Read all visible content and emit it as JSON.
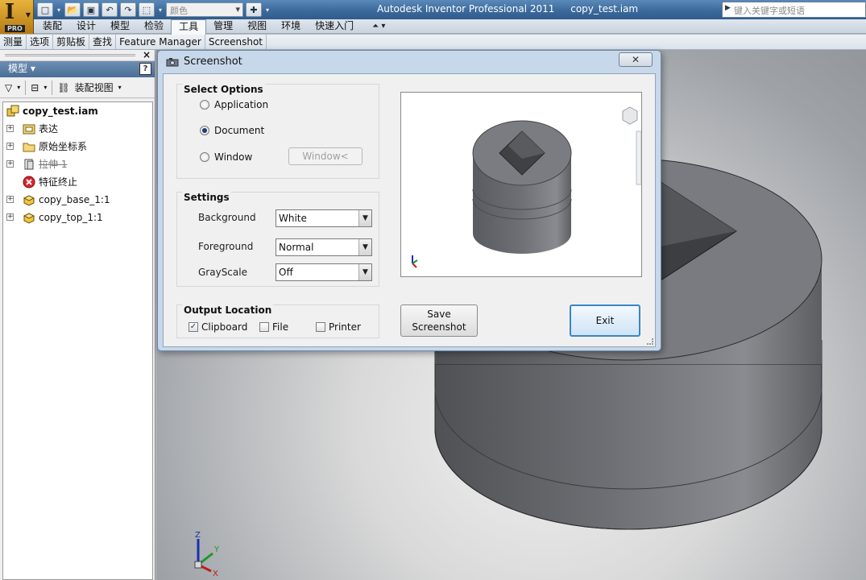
{
  "app": {
    "title": "Autodesk Inventor Professional 2011",
    "document": "copy_test.iam",
    "logo_letter": "I",
    "logo_badge": "PRO",
    "color_combo": "颜色",
    "search_placeholder": "键入关键字或短语"
  },
  "ribbon": {
    "tabs": [
      "装配",
      "设计",
      "模型",
      "检验",
      "工具",
      "管理",
      "视图",
      "环境",
      "快速入门"
    ],
    "active_tab": "工具",
    "sub_items": [
      "测量",
      "选项",
      "剪贴板",
      "查找",
      "Feature Manager",
      "Screenshot"
    ]
  },
  "browser": {
    "header": "模型",
    "help": "?",
    "view_label": "装配视图",
    "tree": {
      "root": "copy_test.iam",
      "nodes": [
        {
          "label": "表达",
          "icon": "representations-icon"
        },
        {
          "label": "原始坐标系",
          "icon": "folder-icon"
        },
        {
          "label": "拉伸 1",
          "icon": "extrude-icon"
        },
        {
          "label": "特征终止",
          "icon": "end-of-features-icon"
        },
        {
          "label": "copy_base_1:1",
          "icon": "part-icon"
        },
        {
          "label": "copy_top_1:1",
          "icon": "part-icon"
        }
      ]
    }
  },
  "dialog": {
    "title": "Screenshot",
    "select_options": {
      "title": "Select Options",
      "application": "Application",
      "document": "Document",
      "window": "Window",
      "window_button": "Window<",
      "selected": "Document"
    },
    "settings": {
      "title": "Settings",
      "background_label": "Background",
      "background_value": "White",
      "foreground_label": "Foreground",
      "foreground_value": "Normal",
      "grayscale_label": "GrayScale",
      "grayscale_value": "Off"
    },
    "output": {
      "title": "Output Location",
      "clipboard": "Clipboard",
      "file": "File",
      "printer": "Printer",
      "clipboard_checked": true,
      "file_checked": false,
      "printer_checked": false
    },
    "save_button_line1": "Save",
    "save_button_line2": "Screenshot",
    "exit_button": "Exit"
  },
  "triad": {
    "z": "Z",
    "y": "Y",
    "x": "X"
  },
  "colors": {
    "titlebar": "#3c6a9c",
    "model_gray": "#6e6f73",
    "dialog_frame": "#c7d8ea"
  }
}
